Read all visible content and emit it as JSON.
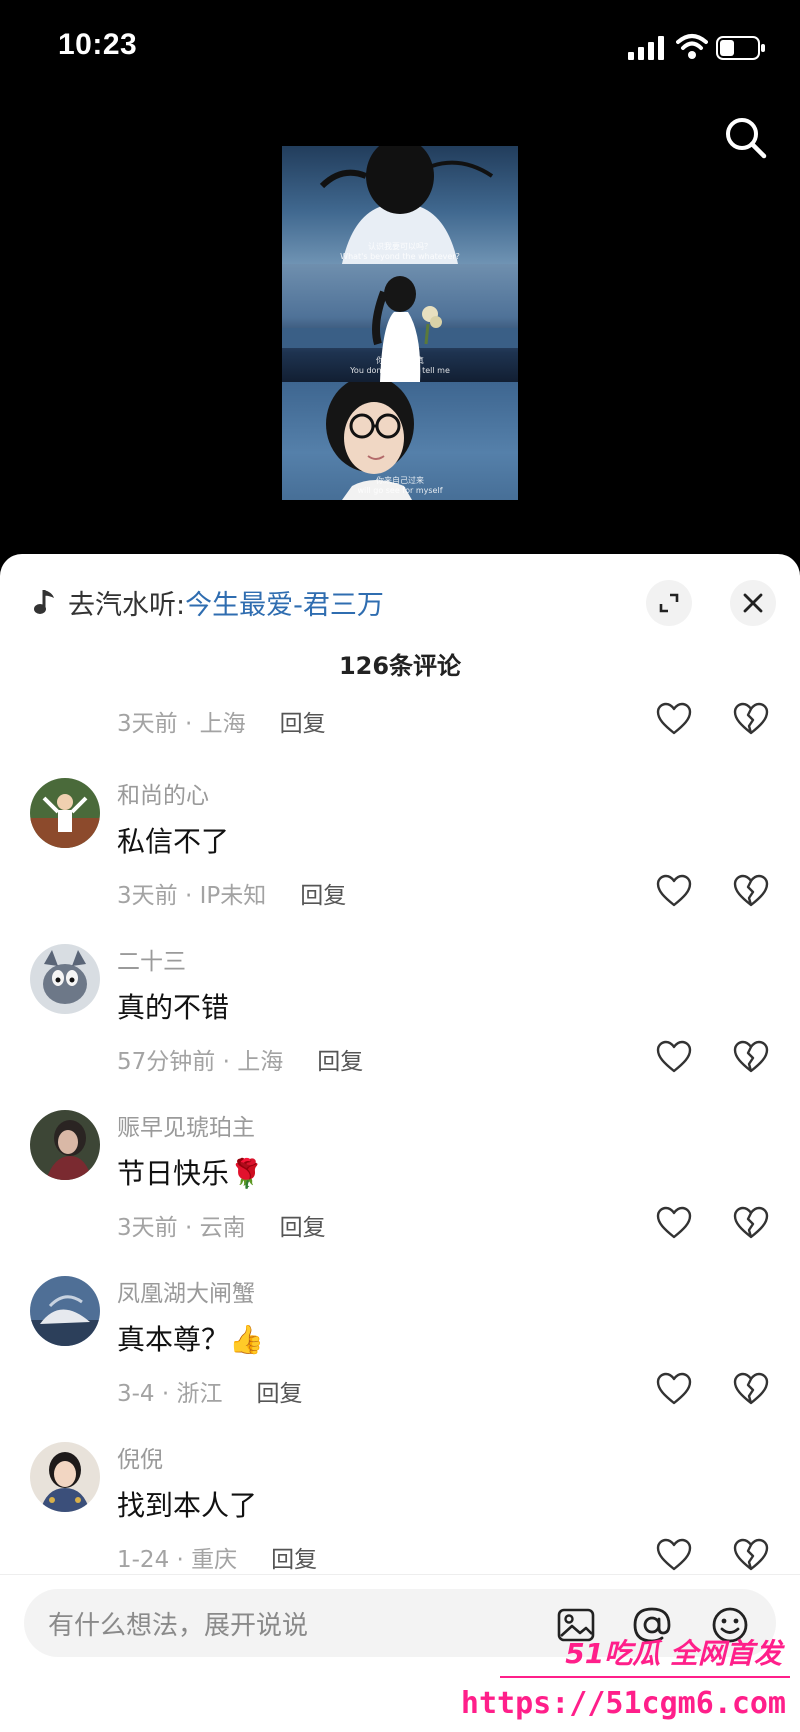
{
  "status_bar": {
    "time": "10:23"
  },
  "video": {
    "captions": [
      "认识我要可以吗？",
      "你不用太认真",
      "你来自己过来"
    ],
    "subcaptions": [
      "What's beyond the whatever?",
      "You don't have to tell me",
      "will go see for myself"
    ]
  },
  "sheet": {
    "music_prefix": "去汽水听:",
    "music_title": "今生最爱-君三万",
    "comment_count": "126条评论",
    "reply_label": "回复",
    "first_meta": "3天前 · 上海",
    "comments": [
      {
        "user": "和尚的心",
        "text": "私信不了",
        "meta": "3天前 · IP未知"
      },
      {
        "user": "二十三",
        "text": "真的不错",
        "meta": "57分钟前 · 上海"
      },
      {
        "user": "赈早见琥珀主",
        "text": "节日快乐🌹",
        "meta": "3天前 · 云南"
      },
      {
        "user": "凤凰湖大闸蟹",
        "text": "真本尊？👍",
        "meta": "3-4 · 浙江"
      },
      {
        "user": "倪倪",
        "text": "找到本人了",
        "meta": "1-24 · 重庆"
      }
    ]
  },
  "input_bar": {
    "placeholder": "有什么想法，展开说说"
  },
  "watermark": {
    "title": "51吃瓜 全网首发",
    "url": "https://51cgm6.com"
  },
  "colors": {
    "accent_link": "#2f6db0",
    "watermark": "#ff1f8a"
  },
  "icons": [
    "search-icon",
    "music-note-icon",
    "expand-icon",
    "close-icon",
    "heart-icon",
    "broken-heart-icon",
    "image-icon",
    "at-icon",
    "emoji-icon"
  ]
}
